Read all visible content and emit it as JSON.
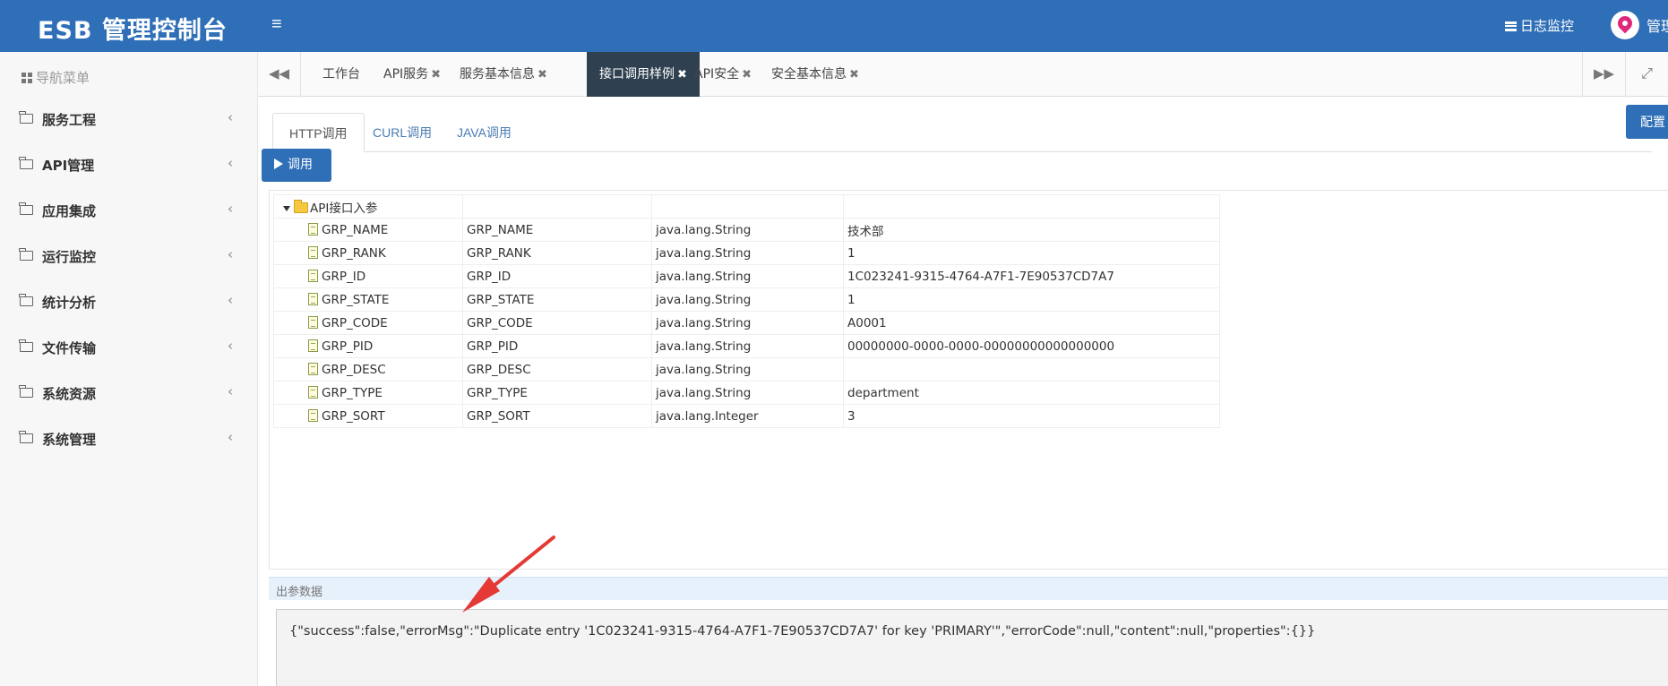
{
  "header": {
    "brand": "ESB 管理控制台",
    "menu_icon": "≡",
    "log_monitor": "日志监控",
    "admin": "管理"
  },
  "sidebar": {
    "title": "导航菜单",
    "items": [
      {
        "label": "服务工程"
      },
      {
        "label": "API管理"
      },
      {
        "label": "应用集成"
      },
      {
        "label": "运行监控"
      },
      {
        "label": "统计分析"
      },
      {
        "label": "文件传输"
      },
      {
        "label": "系统资源"
      },
      {
        "label": "系统管理"
      }
    ]
  },
  "tabs": {
    "items": [
      {
        "label": "工作台",
        "closable": false
      },
      {
        "label": "API服务",
        "closable": true
      },
      {
        "label": "服务基本信息",
        "closable": true
      },
      {
        "label": "接口调用样例",
        "closable": true,
        "active": true
      },
      {
        "label": "API安全",
        "closable": true
      },
      {
        "label": "安全基本信息",
        "closable": true
      }
    ]
  },
  "subtabs": [
    "HTTP调用",
    "CURL调用",
    "JAVA调用"
  ],
  "config_button": "配置",
  "invoke_button": "调用",
  "params": {
    "root": "API接口入参",
    "rows": [
      {
        "name": "GRP_NAME",
        "code": "GRP_NAME",
        "type": "java.lang.String",
        "value": "技术部"
      },
      {
        "name": "GRP_RANK",
        "code": "GRP_RANK",
        "type": "java.lang.String",
        "value": "1"
      },
      {
        "name": "GRP_ID",
        "code": "GRP_ID",
        "type": "java.lang.String",
        "value": "1C023241-9315-4764-A7F1-7E90537CD7A7"
      },
      {
        "name": "GRP_STATE",
        "code": "GRP_STATE",
        "type": "java.lang.String",
        "value": "1"
      },
      {
        "name": "GRP_CODE",
        "code": "GRP_CODE",
        "type": "java.lang.String",
        "value": "A0001"
      },
      {
        "name": "GRP_PID",
        "code": "GRP_PID",
        "type": "java.lang.String",
        "value": "00000000-0000-0000-00000000000000000"
      },
      {
        "name": "GRP_DESC",
        "code": "GRP_DESC",
        "type": "java.lang.String",
        "value": ""
      },
      {
        "name": "GRP_TYPE",
        "code": "GRP_TYPE",
        "type": "java.lang.String",
        "value": "department"
      },
      {
        "name": "GRP_SORT",
        "code": "GRP_SORT",
        "type": "java.lang.Integer",
        "value": "3"
      }
    ]
  },
  "output": {
    "title": "出参数据",
    "text": "{\"success\":false,\"errorMsg\":\"Duplicate entry '1C023241-9315-4764-A7F1-7E90537CD7A7' for key 'PRIMARY'\",\"errorCode\":null,\"content\":null,\"properties\":{}}"
  },
  "colors": {
    "header_bg": "#2f6fb7",
    "active_tab_bg": "#2f4050",
    "arrow": "#e53935"
  }
}
